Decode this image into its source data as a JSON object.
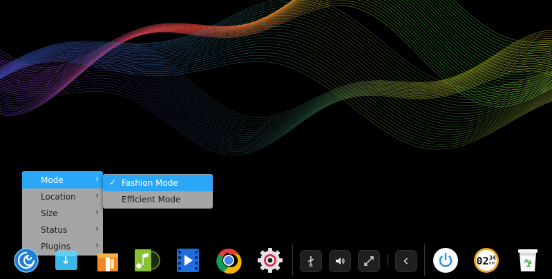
{
  "context_menu": {
    "items": [
      {
        "label": "Mode",
        "has_submenu": true,
        "active": true
      },
      {
        "label": "Location",
        "has_submenu": true
      },
      {
        "label": "Size",
        "has_submenu": true
      },
      {
        "label": "Status",
        "has_submenu": true
      },
      {
        "label": "Plugins",
        "has_submenu": true
      }
    ],
    "submenu_arrow": "›"
  },
  "mode_submenu": {
    "items": [
      {
        "label": "Fashion Mode",
        "checked": true
      },
      {
        "label": "Efficient Mode",
        "checked": false
      }
    ],
    "check_glyph": "✓"
  },
  "dock": {
    "apps": [
      {
        "icon": "launcher-icon"
      },
      {
        "icon": "file-manager-icon"
      },
      {
        "icon": "app-store-icon"
      },
      {
        "icon": "music-icon"
      },
      {
        "icon": "movie-icon"
      },
      {
        "icon": "chrome-icon"
      },
      {
        "icon": "settings-icon"
      }
    ],
    "tray": [
      {
        "icon": "usb-icon"
      },
      {
        "icon": "volume-icon"
      },
      {
        "icon": "network-icon"
      },
      {
        "icon": "collapse-arrow-icon"
      }
    ],
    "power": {
      "icon": "power-icon"
    },
    "clock": {
      "hour": "02",
      "minute": "34",
      "ampm": "PM"
    },
    "trash": {
      "icon": "trash-icon"
    }
  },
  "colors": {
    "accent": "#2ca7f8",
    "menu_bg": "#b2b2b2",
    "dock_bg": "#000000"
  }
}
